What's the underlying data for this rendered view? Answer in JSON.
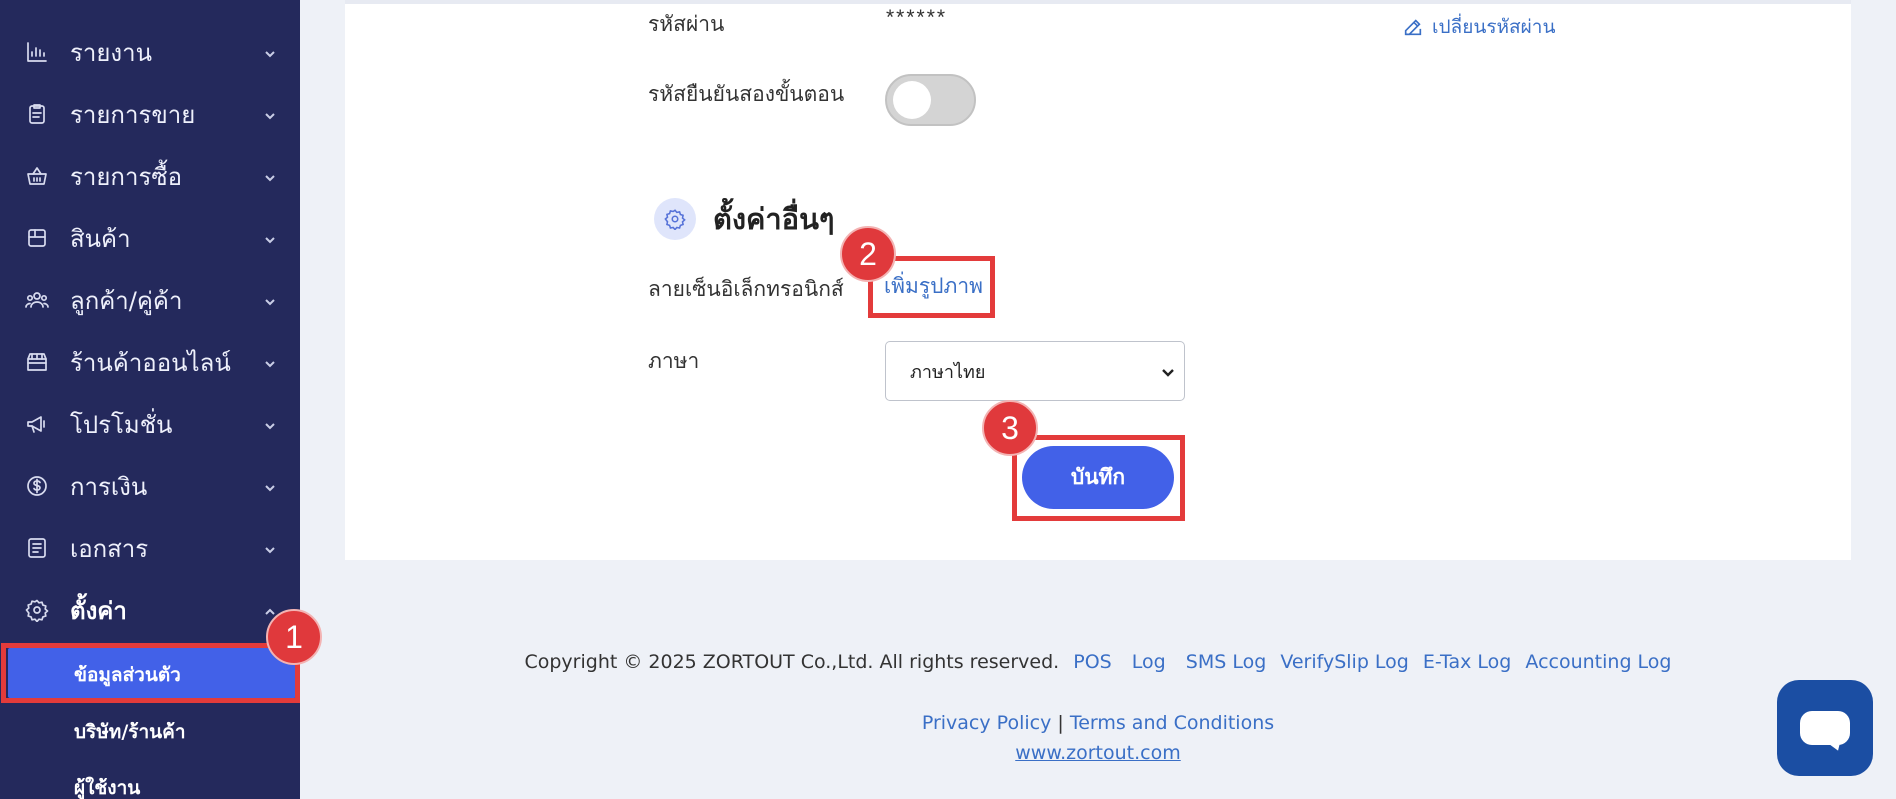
{
  "sidebar": {
    "items": [
      {
        "label": "รายงาน",
        "icon": "chart-icon"
      },
      {
        "label": "รายการขาย",
        "icon": "clipboard-icon"
      },
      {
        "label": "รายการซื้อ",
        "icon": "basket-icon"
      },
      {
        "label": "สินค้า",
        "icon": "box-icon"
      },
      {
        "label": "ลูกค้า/คู่ค้า",
        "icon": "users-icon"
      },
      {
        "label": "ร้านค้าออนไลน์",
        "icon": "store-icon"
      },
      {
        "label": "โปรโมชั่น",
        "icon": "megaphone-icon"
      },
      {
        "label": "การเงิน",
        "icon": "dollar-icon"
      },
      {
        "label": "เอกสาร",
        "icon": "document-icon"
      },
      {
        "label": "ตั้งค่า",
        "icon": "gear-icon"
      }
    ],
    "settings_sub": [
      {
        "label": "ข้อมูลส่วนตัว"
      },
      {
        "label": "บริษัท/ร้านค้า"
      },
      {
        "label": "ผู้ใช้งาน"
      }
    ]
  },
  "form": {
    "password_label": "รหัสผ่าน",
    "password_value": "******",
    "change_password": "เปลี่ยนรหัสผ่าน",
    "twofa_label": "รหัสยืนยันสองขั้นตอน",
    "twofa_enabled": false,
    "section_title": "ตั้งค่าอื่นๆ",
    "esign_label": "ลายเซ็นอิเล็กทรอนิกส์",
    "add_image": "เพิ่มรูปภาพ",
    "language_label": "ภาษา",
    "language_value": "ภาษาไทย",
    "save_label": "บันทึก"
  },
  "annotations": {
    "step1": "1",
    "step2": "2",
    "step3": "3"
  },
  "footer": {
    "copyright": "Copyright © 2025 ZORTOUT Co.,Ltd. All rights reserved.",
    "links": [
      "POS",
      "Log",
      "SMS Log",
      "VerifySlip Log",
      "E-Tax Log",
      "Accounting Log"
    ],
    "privacy": "Privacy Policy",
    "separator": "|",
    "terms": "Terms and Conditions",
    "website": "www.zortout.com"
  },
  "colors": {
    "sidebar_bg": "#24295c",
    "accent": "#4261e8",
    "highlight_frame": "#e33b3b",
    "chat_button": "#1b4ea3"
  }
}
